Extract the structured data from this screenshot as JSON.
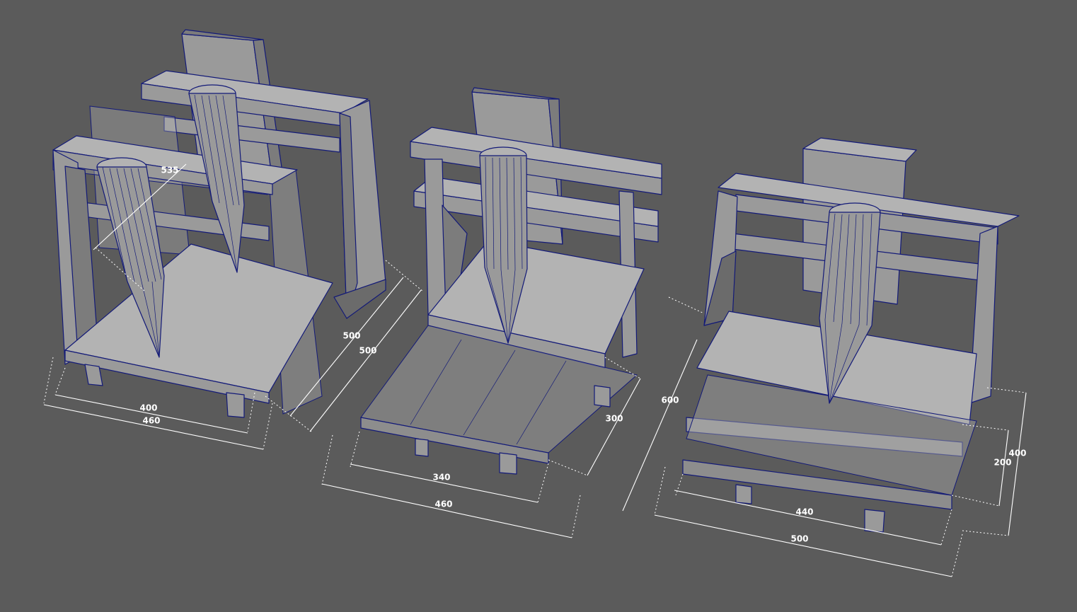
{
  "dimensions": {
    "m1": {
      "depth_inner": "535",
      "width_inner": "400",
      "width_outer": "460",
      "depth_a": "500",
      "depth_b": "500"
    },
    "m2": {
      "width_inner": "340",
      "width_outer": "460",
      "depth": "300"
    },
    "m3": {
      "height": "600",
      "width_inner": "440",
      "width_outer": "500",
      "z_inner": "200",
      "z_outer": "400"
    }
  },
  "colors": {
    "background": "#5b5b5b",
    "wireframe": "#131a78",
    "dimension": "#ffffff"
  }
}
